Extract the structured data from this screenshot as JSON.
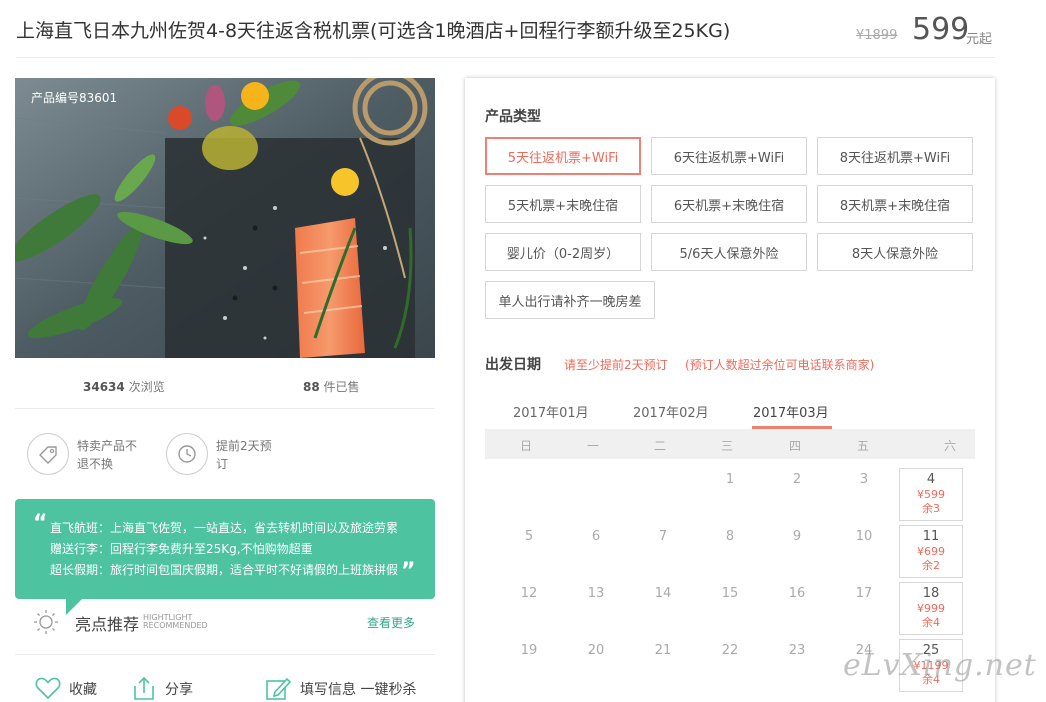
{
  "header": {
    "title": "上海直飞日本九州佐贺4-8天往返含税机票(可选含1晚酒店+回程行李额升级至25KG)",
    "price_old": "¥1899",
    "price_new": "599",
    "price_unit": "元起"
  },
  "product": {
    "code_label": "产品编号83601",
    "views_count": "34634",
    "views_label": "次浏览",
    "sold_count": "88",
    "sold_label": "件已售"
  },
  "features": [
    {
      "icon": "tag-icon",
      "line1": "特卖产品不",
      "line2": "退不换"
    },
    {
      "icon": "clock-icon",
      "line1": "提前2天预",
      "line2": "订"
    }
  ],
  "highlights": {
    "lines": [
      "直飞航班：上海直飞佐贺，一站直达，省去转机时间以及旅途劳累",
      "赠送行李：回程行李免费升至25Kg,不怕购物超重",
      "超长假期：旅行时间包国庆假期，适合平时不好请假的上班族拼假"
    ],
    "title": "亮点推荐",
    "subtitle_en_1": "HIGHTLIGHT",
    "subtitle_en_2": "RECOMMENDED",
    "more_label": "查看更多"
  },
  "actions": {
    "favorite": "收藏",
    "share": "分享",
    "fill_info": "填写信息 一键秒杀"
  },
  "product_type": {
    "title": "产品类型",
    "options": [
      "5天往返机票+WiFi",
      "6天往返机票+WiFi",
      "8天往返机票+WiFi",
      "5天机票+末晚住宿",
      "6天机票+末晚住宿",
      "8天机票+末晚住宿",
      "婴儿价（0-2周岁）",
      "5/6天人保意外险",
      "8天人保意外险",
      "单人出行请补齐一晚房差"
    ],
    "selected_index": 0
  },
  "departure": {
    "title": "出发日期",
    "note1": "请至少提前2天预订",
    "note2": "(预订人数超过余位可电话联系商家)",
    "months": [
      "2017年01月",
      "2017年02月",
      "2017年03月"
    ],
    "active_month_index": 2,
    "weekdays": [
      "日",
      "一",
      "二",
      "三",
      "四",
      "五",
      "六"
    ],
    "rows": [
      [
        "",
        "",
        "",
        "1",
        "2",
        "3",
        "4"
      ],
      [
        "5",
        "6",
        "7",
        "8",
        "9",
        "10",
        "11"
      ],
      [
        "12",
        "13",
        "14",
        "15",
        "16",
        "17",
        "18"
      ],
      [
        "19",
        "20",
        "21",
        "22",
        "23",
        "24",
        "25"
      ]
    ],
    "available": [
      {
        "day": "4",
        "price": "¥599",
        "remain": "余3"
      },
      {
        "day": "11",
        "price": "¥699",
        "remain": "余2"
      },
      {
        "day": "18",
        "price": "¥999",
        "remain": "余4"
      },
      {
        "day": "25",
        "price": "¥1199",
        "remain": "余4"
      }
    ]
  },
  "watermark": "eLvXing.net",
  "colors": {
    "accent": "#f06a5a",
    "green": "#4ec3a0",
    "link_green": "#32a886"
  }
}
